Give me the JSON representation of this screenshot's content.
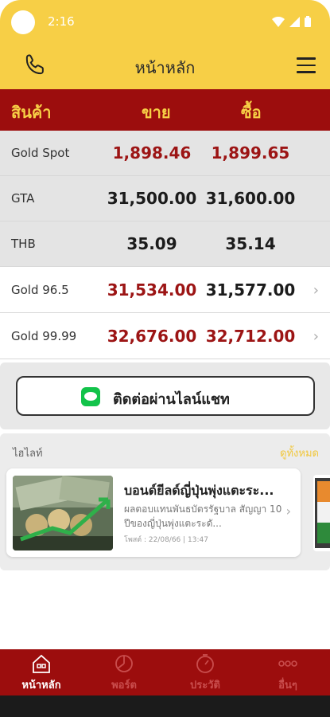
{
  "status": {
    "time": "2:16"
  },
  "header": {
    "title": "หน้าหลัก",
    "phone_icon": "phone-icon",
    "menu_icon": "hamburger-menu-icon"
  },
  "table": {
    "columns": [
      "สินค้า",
      "ขาย",
      "ซื้อ"
    ],
    "rows": [
      {
        "name": "Gold Spot",
        "sell": "1,898.46",
        "buy": "1,899.65"
      },
      {
        "name": "GTA",
        "sell": "31,500.00",
        "buy": "31,600.00"
      },
      {
        "name": "THB",
        "sell": "35.09",
        "buy": "35.14"
      },
      {
        "name": "Gold 96.5",
        "sell": "31,534.00",
        "buy": "31,577.00"
      },
      {
        "name": "Gold 99.99",
        "sell": "32,676.00",
        "buy": "32,712.00"
      }
    ]
  },
  "line_chat": {
    "label": "ติดต่อผ่านไลน์แชท",
    "icon": "line-app-icon"
  },
  "highlight": {
    "title": "ไฮไลท์",
    "see_all": "ดูทั้งหมด",
    "card": {
      "headline": "บอนด์ยีลด์ญี่ปุ่นพุ่งแตะระ...",
      "description": "ผลตอบแทนพันธบัตรรัฐบาล สัญญา 10 ปีของญี่ปุ่นพุ่งแตะระดั...",
      "date": "โพสต์ : 22/08/66 | 13:47"
    }
  },
  "bottom_nav": [
    {
      "label": "หน้าหลัก",
      "icon": "home-icon",
      "active": true
    },
    {
      "label": "พอร์ต",
      "icon": "portfolio-icon",
      "active": false
    },
    {
      "label": "ประวัติ",
      "icon": "history-icon",
      "active": false
    },
    {
      "label": "อื่นๆ",
      "icon": "more-icon",
      "active": false
    }
  ],
  "colors": {
    "accent": "#f7cf46",
    "brand_red": "#9c0d0d",
    "price_red": "#9c1414",
    "line_green": "#12c34a"
  }
}
